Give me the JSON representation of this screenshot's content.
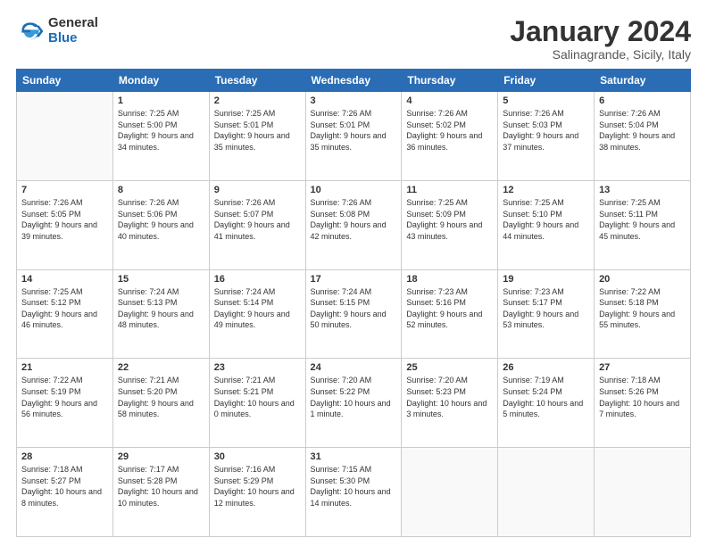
{
  "header": {
    "logo": {
      "general": "General",
      "blue": "Blue"
    },
    "title": "January 2024",
    "location": "Salinagrande, Sicily, Italy"
  },
  "days_of_week": [
    "Sunday",
    "Monday",
    "Tuesday",
    "Wednesday",
    "Thursday",
    "Friday",
    "Saturday"
  ],
  "weeks": [
    [
      {
        "day": "",
        "sunrise": "",
        "sunset": "",
        "daylight": ""
      },
      {
        "day": "1",
        "sunrise": "Sunrise: 7:25 AM",
        "sunset": "Sunset: 5:00 PM",
        "daylight": "Daylight: 9 hours and 34 minutes."
      },
      {
        "day": "2",
        "sunrise": "Sunrise: 7:25 AM",
        "sunset": "Sunset: 5:01 PM",
        "daylight": "Daylight: 9 hours and 35 minutes."
      },
      {
        "day": "3",
        "sunrise": "Sunrise: 7:26 AM",
        "sunset": "Sunset: 5:01 PM",
        "daylight": "Daylight: 9 hours and 35 minutes."
      },
      {
        "day": "4",
        "sunrise": "Sunrise: 7:26 AM",
        "sunset": "Sunset: 5:02 PM",
        "daylight": "Daylight: 9 hours and 36 minutes."
      },
      {
        "day": "5",
        "sunrise": "Sunrise: 7:26 AM",
        "sunset": "Sunset: 5:03 PM",
        "daylight": "Daylight: 9 hours and 37 minutes."
      },
      {
        "day": "6",
        "sunrise": "Sunrise: 7:26 AM",
        "sunset": "Sunset: 5:04 PM",
        "daylight": "Daylight: 9 hours and 38 minutes."
      }
    ],
    [
      {
        "day": "7",
        "sunrise": "Sunrise: 7:26 AM",
        "sunset": "Sunset: 5:05 PM",
        "daylight": "Daylight: 9 hours and 39 minutes."
      },
      {
        "day": "8",
        "sunrise": "Sunrise: 7:26 AM",
        "sunset": "Sunset: 5:06 PM",
        "daylight": "Daylight: 9 hours and 40 minutes."
      },
      {
        "day": "9",
        "sunrise": "Sunrise: 7:26 AM",
        "sunset": "Sunset: 5:07 PM",
        "daylight": "Daylight: 9 hours and 41 minutes."
      },
      {
        "day": "10",
        "sunrise": "Sunrise: 7:26 AM",
        "sunset": "Sunset: 5:08 PM",
        "daylight": "Daylight: 9 hours and 42 minutes."
      },
      {
        "day": "11",
        "sunrise": "Sunrise: 7:25 AM",
        "sunset": "Sunset: 5:09 PM",
        "daylight": "Daylight: 9 hours and 43 minutes."
      },
      {
        "day": "12",
        "sunrise": "Sunrise: 7:25 AM",
        "sunset": "Sunset: 5:10 PM",
        "daylight": "Daylight: 9 hours and 44 minutes."
      },
      {
        "day": "13",
        "sunrise": "Sunrise: 7:25 AM",
        "sunset": "Sunset: 5:11 PM",
        "daylight": "Daylight: 9 hours and 45 minutes."
      }
    ],
    [
      {
        "day": "14",
        "sunrise": "Sunrise: 7:25 AM",
        "sunset": "Sunset: 5:12 PM",
        "daylight": "Daylight: 9 hours and 46 minutes."
      },
      {
        "day": "15",
        "sunrise": "Sunrise: 7:24 AM",
        "sunset": "Sunset: 5:13 PM",
        "daylight": "Daylight: 9 hours and 48 minutes."
      },
      {
        "day": "16",
        "sunrise": "Sunrise: 7:24 AM",
        "sunset": "Sunset: 5:14 PM",
        "daylight": "Daylight: 9 hours and 49 minutes."
      },
      {
        "day": "17",
        "sunrise": "Sunrise: 7:24 AM",
        "sunset": "Sunset: 5:15 PM",
        "daylight": "Daylight: 9 hours and 50 minutes."
      },
      {
        "day": "18",
        "sunrise": "Sunrise: 7:23 AM",
        "sunset": "Sunset: 5:16 PM",
        "daylight": "Daylight: 9 hours and 52 minutes."
      },
      {
        "day": "19",
        "sunrise": "Sunrise: 7:23 AM",
        "sunset": "Sunset: 5:17 PM",
        "daylight": "Daylight: 9 hours and 53 minutes."
      },
      {
        "day": "20",
        "sunrise": "Sunrise: 7:22 AM",
        "sunset": "Sunset: 5:18 PM",
        "daylight": "Daylight: 9 hours and 55 minutes."
      }
    ],
    [
      {
        "day": "21",
        "sunrise": "Sunrise: 7:22 AM",
        "sunset": "Sunset: 5:19 PM",
        "daylight": "Daylight: 9 hours and 56 minutes."
      },
      {
        "day": "22",
        "sunrise": "Sunrise: 7:21 AM",
        "sunset": "Sunset: 5:20 PM",
        "daylight": "Daylight: 9 hours and 58 minutes."
      },
      {
        "day": "23",
        "sunrise": "Sunrise: 7:21 AM",
        "sunset": "Sunset: 5:21 PM",
        "daylight": "Daylight: 10 hours and 0 minutes."
      },
      {
        "day": "24",
        "sunrise": "Sunrise: 7:20 AM",
        "sunset": "Sunset: 5:22 PM",
        "daylight": "Daylight: 10 hours and 1 minute."
      },
      {
        "day": "25",
        "sunrise": "Sunrise: 7:20 AM",
        "sunset": "Sunset: 5:23 PM",
        "daylight": "Daylight: 10 hours and 3 minutes."
      },
      {
        "day": "26",
        "sunrise": "Sunrise: 7:19 AM",
        "sunset": "Sunset: 5:24 PM",
        "daylight": "Daylight: 10 hours and 5 minutes."
      },
      {
        "day": "27",
        "sunrise": "Sunrise: 7:18 AM",
        "sunset": "Sunset: 5:26 PM",
        "daylight": "Daylight: 10 hours and 7 minutes."
      }
    ],
    [
      {
        "day": "28",
        "sunrise": "Sunrise: 7:18 AM",
        "sunset": "Sunset: 5:27 PM",
        "daylight": "Daylight: 10 hours and 8 minutes."
      },
      {
        "day": "29",
        "sunrise": "Sunrise: 7:17 AM",
        "sunset": "Sunset: 5:28 PM",
        "daylight": "Daylight: 10 hours and 10 minutes."
      },
      {
        "day": "30",
        "sunrise": "Sunrise: 7:16 AM",
        "sunset": "Sunset: 5:29 PM",
        "daylight": "Daylight: 10 hours and 12 minutes."
      },
      {
        "day": "31",
        "sunrise": "Sunrise: 7:15 AM",
        "sunset": "Sunset: 5:30 PM",
        "daylight": "Daylight: 10 hours and 14 minutes."
      },
      {
        "day": "",
        "sunrise": "",
        "sunset": "",
        "daylight": ""
      },
      {
        "day": "",
        "sunrise": "",
        "sunset": "",
        "daylight": ""
      },
      {
        "day": "",
        "sunrise": "",
        "sunset": "",
        "daylight": ""
      }
    ]
  ]
}
